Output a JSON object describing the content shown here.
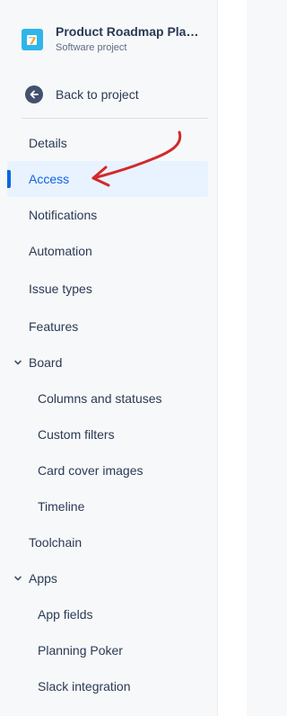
{
  "project": {
    "name": "Product Roadmap Placeholder",
    "type": "Software project"
  },
  "back": {
    "label": "Back to project"
  },
  "nav": {
    "details": "Details",
    "access": "Access",
    "notifications": "Notifications",
    "automation": "Automation",
    "issue_types": "Issue types",
    "features": "Features",
    "board": "Board",
    "columns_and_statuses": "Columns and statuses",
    "custom_filters": "Custom filters",
    "card_cover_images": "Card cover images",
    "timeline": "Timeline",
    "toolchain": "Toolchain",
    "apps": "Apps",
    "app_fields": "App fields",
    "planning_poker": "Planning Poker",
    "slack_integration": "Slack integration"
  },
  "active_item": "Access",
  "colors": {
    "active_background": "#e9f2ff",
    "active_accent": "#0c66e4",
    "annotation_arrow": "#d12a2a",
    "project_avatar": "#2fb5e9"
  }
}
